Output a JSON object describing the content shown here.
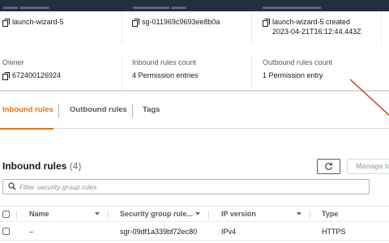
{
  "details": {
    "name": {
      "value": "launch-wizard-5"
    },
    "group_id": {
      "value": "sg-011969c9693ee8b0a"
    },
    "description": {
      "value": "launch-wizard-5 created",
      "value_line2": "2023-04-21T16:12:44.443Z"
    },
    "owner": {
      "label": "Owner",
      "value": "672400126924"
    },
    "inbound_count": {
      "label": "Inbound rules count",
      "value": "4 Permission entries"
    },
    "outbound_count": {
      "label": "Outbound rules count",
      "value": "1 Permission entry"
    }
  },
  "tabs": [
    {
      "label": "Inbound rules",
      "active": true
    },
    {
      "label": "Outbound rules",
      "active": false
    },
    {
      "label": "Tags",
      "active": false
    }
  ],
  "inbound_panel": {
    "title": "Inbound rules",
    "count": "(4)",
    "manage_label": "Manage tags",
    "search_placeholder": "Filter security group rules"
  },
  "table": {
    "columns": [
      "Name",
      "Security group rule...",
      "IP version",
      "Type"
    ],
    "rows": [
      {
        "name": "–",
        "rule_id": "sgr-09df1a339bf72ec80",
        "ip_version": "IPv4",
        "type": "HTTPS"
      }
    ]
  },
  "colors": {
    "accent": "#ec7211",
    "annotation": "#d13212",
    "topbar": "#232f3e"
  },
  "icons": [
    "copy-icon",
    "refresh-icon",
    "search-icon",
    "sort-caret-icon"
  ]
}
